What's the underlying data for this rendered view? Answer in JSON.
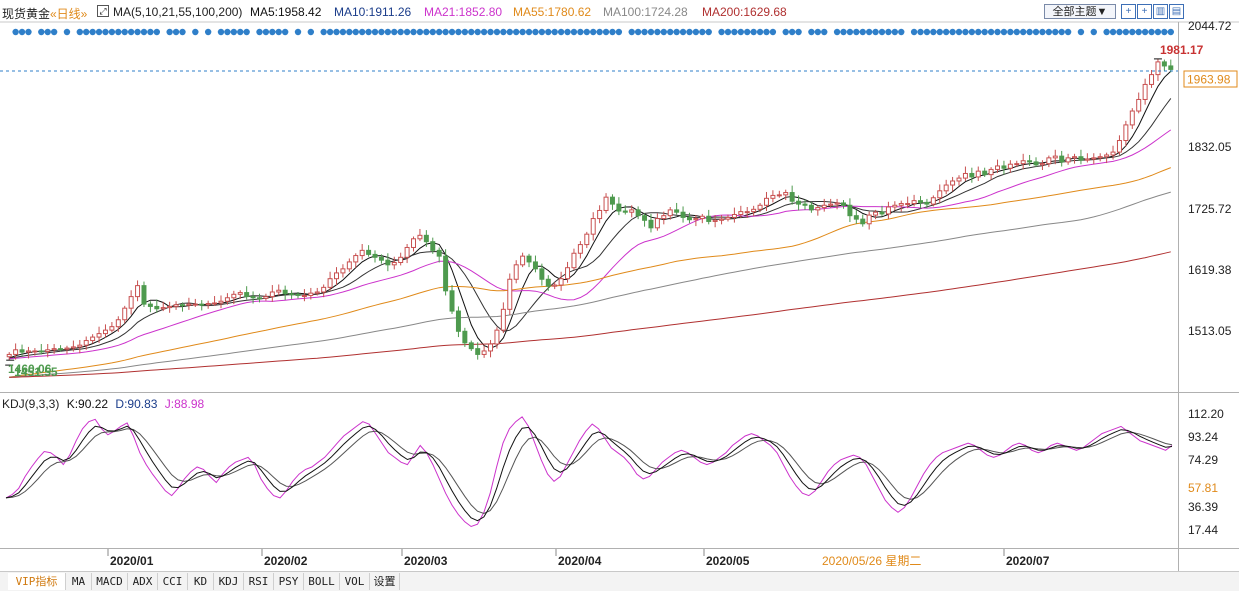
{
  "header": {
    "instrument": "现货黄金",
    "period": "«日线»",
    "ma_params": "MA(5,10,21,55,100,200)",
    "ma5": "MA5:1958.42",
    "ma10": "MA10:1911.26",
    "ma21": "MA21:1852.80",
    "ma55": "MA55:1780.62",
    "ma100": "MA100:1724.28",
    "ma200": "MA200:1629.68",
    "theme_button": "全部主题▼",
    "icons": [
      "plus-square-icon",
      "plus-square-icon",
      "chart-icon",
      "chart-icon"
    ]
  },
  "colors": {
    "up": "#c85050",
    "down": "#4e9a4e",
    "ma5": "#111111",
    "ma10": "#333333",
    "ma21": "#cc33cc",
    "ma55": "#e08a1a",
    "ma100": "#888888",
    "ma200": "#b03030",
    "k": "#111111",
    "d": "#555555",
    "j": "#cc33cc",
    "dots": "#2f7fc9"
  },
  "chart_data": [
    {
      "type": "candlestick",
      "title": "现货黄金 日线",
      "x_ticks": [
        "2020/01",
        "2020/02",
        "2020/03",
        "2020/04",
        "2020/05",
        "2020/07"
      ],
      "highlight_date": "2020/05/26 星期二",
      "y_ticks": [
        "2044.72",
        "1832.05",
        "1725.72",
        "1619.38",
        "1513.05"
      ],
      "ylim": [
        1405,
        2045
      ],
      "current_price": "1963.98",
      "high_label": "1981.17",
      "high_value": 1981.17,
      "low_label": "1451.55",
      "low_value": 1451.55,
      "start_label": "1460.06",
      "start_value": 1460.06,
      "close": [
        1470,
        1478,
        1474,
        1476,
        1476,
        1475,
        1478,
        1480,
        1479,
        1481,
        1483,
        1486,
        1494,
        1500,
        1506,
        1512,
        1518,
        1530,
        1550,
        1570,
        1589,
        1557,
        1553,
        1549,
        1551,
        1553,
        1556,
        1555,
        1557,
        1557,
        1556,
        1558,
        1559,
        1562,
        1568,
        1574,
        1577,
        1570,
        1568,
        1567,
        1570,
        1578,
        1581,
        1575,
        1574,
        1572,
        1572,
        1576,
        1578,
        1586,
        1601,
        1611,
        1618,
        1630,
        1641,
        1650,
        1643,
        1638,
        1633,
        1625,
        1629,
        1638,
        1655,
        1670,
        1676,
        1665,
        1650,
        1640,
        1580,
        1545,
        1510,
        1490,
        1480,
        1470,
        1476,
        1488,
        1512,
        1548,
        1600,
        1625,
        1640,
        1630,
        1618,
        1600,
        1588,
        1590,
        1601,
        1620,
        1645,
        1660,
        1678,
        1705,
        1719,
        1742,
        1730,
        1718,
        1716,
        1720,
        1710,
        1702,
        1689,
        1705,
        1710,
        1720,
        1716,
        1707,
        1703,
        1705,
        1709,
        1700,
        1702,
        1704,
        1707,
        1712,
        1717,
        1717,
        1721,
        1728,
        1740,
        1745,
        1746,
        1750,
        1735,
        1730,
        1728,
        1720,
        1724,
        1728,
        1730,
        1732,
        1728,
        1710,
        1704,
        1696,
        1711,
        1716,
        1713,
        1725,
        1728,
        1731,
        1731,
        1736,
        1733,
        1730,
        1741,
        1753,
        1763,
        1770,
        1775,
        1783,
        1777,
        1787,
        1781,
        1790,
        1796,
        1792,
        1799,
        1800,
        1805,
        1803,
        1798,
        1800,
        1810,
        1813,
        1803,
        1810,
        1812,
        1806,
        1808,
        1810,
        1812,
        1815,
        1820,
        1840,
        1867,
        1891,
        1911,
        1937,
        1954,
        1976,
        1969,
        1963
      ]
    },
    {
      "type": "line",
      "title": "KDJ(9,3,3)",
      "series": [
        {
          "name": "K",
          "label": "K:90.22",
          "last": 90.22
        },
        {
          "name": "D",
          "label": "D:90.83",
          "last": 90.83
        },
        {
          "name": "J",
          "label": "J:88.98",
          "last": 88.98
        }
      ],
      "y_ticks": [
        "112.20",
        "93.24",
        "74.29",
        "57.81",
        "36.39",
        "17.44"
      ],
      "ylim": [
        0,
        120
      ],
      "highlight_tick": "57.81",
      "j_values": [
        42,
        45,
        50,
        60,
        68,
        75,
        81,
        80,
        76,
        70,
        78,
        90,
        100,
        106,
        108,
        100,
        95,
        98,
        102,
        105,
        94,
        80,
        70,
        62,
        55,
        48,
        44,
        50,
        58,
        64,
        68,
        66,
        60,
        55,
        62,
        68,
        72,
        74,
        76,
        70,
        58,
        50,
        44,
        42,
        48,
        56,
        62,
        66,
        68,
        72,
        76,
        82,
        88,
        94,
        98,
        102,
        106,
        104,
        96,
        88,
        80,
        76,
        72,
        70,
        78,
        86,
        80,
        70,
        58,
        46,
        36,
        28,
        22,
        18,
        20,
        30,
        46,
        68,
        88,
        100,
        106,
        110,
        102,
        88,
        74,
        62,
        56,
        60,
        70,
        80,
        90,
        98,
        104,
        100,
        92,
        84,
        80,
        76,
        70,
        62,
        58,
        60,
        66,
        72,
        76,
        80,
        82,
        80,
        76,
        72,
        70,
        72,
        76,
        80,
        86,
        90,
        94,
        96,
        94,
        90,
        86,
        80,
        70,
        60,
        52,
        46,
        44,
        48,
        56,
        64,
        70,
        74,
        76,
        78,
        76,
        70,
        60,
        50,
        40,
        34,
        30,
        34,
        42,
        52,
        62,
        70,
        76,
        80,
        82,
        84,
        86,
        88,
        86,
        82,
        78,
        76,
        78,
        82,
        86,
        88,
        86,
        82,
        80,
        82,
        86,
        88,
        86,
        84,
        82,
        84,
        88,
        92,
        96,
        98,
        100,
        102,
        98,
        94,
        90,
        88,
        86,
        84,
        82,
        86
      ],
      "_note": "j_values estimated from plot shape"
    }
  ],
  "tabs": [
    {
      "label": "VIP指标",
      "active": true
    },
    {
      "label": "MA"
    },
    {
      "label": "MACD"
    },
    {
      "label": "ADX"
    },
    {
      "label": "CCI"
    },
    {
      "label": "KD"
    },
    {
      "label": "KDJ"
    },
    {
      "label": "RSI"
    },
    {
      "label": "PSY"
    },
    {
      "label": "BOLL"
    },
    {
      "label": "VOL"
    },
    {
      "label": "设置"
    }
  ]
}
